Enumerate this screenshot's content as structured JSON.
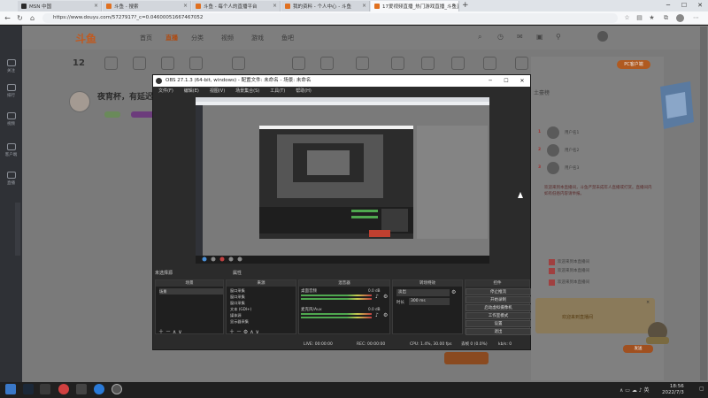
{
  "browser": {
    "tabs": [
      {
        "title": "MSN 中国",
        "active": false
      },
      {
        "title": "斗鱼 - 搜索",
        "active": false
      },
      {
        "title": "斗鱼 - 每个人的直播平台",
        "active": false
      },
      {
        "title": "我的资料 - 个人中心 - 斗鱼",
        "active": false
      },
      {
        "title": "17爱视频直播_热门游戏直播_斗鱼直播",
        "active": true
      }
    ],
    "url": "https://www.douyu.com/5727917?_c=0.04600051667467052",
    "new_tab": "+"
  },
  "page": {
    "logo": "斗鱼",
    "nav": [
      {
        "label": "首页",
        "active": false
      },
      {
        "label": "直播",
        "active": true
      },
      {
        "label": "分类",
        "active": false
      },
      {
        "label": "视频",
        "active": false
      },
      {
        "label": "游戏",
        "active": false
      },
      {
        "label": "鱼吧",
        "active": false
      }
    ],
    "left_sidebar": [
      "关注",
      "排行",
      "视频",
      "客户端",
      "直播"
    ],
    "host_title": "夜宵杯，有延迟",
    "host_level": "12",
    "pc_button": "PC客户端",
    "rank_title": "土豪榜",
    "rank_rows": [
      {
        "rank": "1",
        "name": "用户名1"
      },
      {
        "rank": "2",
        "name": "用户名2"
      },
      {
        "rank": "3",
        "name": "用户名3"
      }
    ],
    "chat_text": "欢迎来到本直播间，斗鱼严禁未成年人直播或打赏。直播间内如有低俗内容请举报。",
    "system_msgs": [
      "欢迎来到本直播间",
      "欢迎来到本直播间",
      "欢迎来到本直播间"
    ],
    "popup_text": "欢迎来到直播间",
    "send_button": "发送"
  },
  "obs": {
    "window_title": "OBS 27.1.3 (64-bit, windows) - 配置文件: 未命名 - 场景: 未命名",
    "menu": [
      "文件(F)",
      "编辑(E)",
      "视图(V)",
      "场景集合(S)",
      "工具(T)",
      "帮助(H)"
    ],
    "scene_label": "未选择源",
    "scene_status": "属性",
    "docks": {
      "scenes": {
        "header": "场景",
        "items": [
          "场景"
        ]
      },
      "sources": {
        "header": "来源",
        "items": [
          "窗口采集",
          "窗口采集",
          "窗口采集",
          "文本 (GDI+)",
          "媒体源",
          "显示器采集"
        ]
      },
      "mixer": {
        "header": "混音器",
        "channels": [
          {
            "name": "桌面音频",
            "db": "0.0 dB"
          },
          {
            "name": "麦克风/Aux",
            "db": "0.0 dB"
          }
        ]
      },
      "transitions": {
        "header": "转场特效",
        "type": "淡出",
        "duration_label": "时长",
        "duration": "300 ms"
      },
      "controls": {
        "header": "控件",
        "buttons": [
          "停止推流",
          "开始录制",
          "启动虚拟摄像机",
          "工作室模式",
          "设置",
          "退出"
        ]
      }
    },
    "status": {
      "dropped": "丢帧 0 (0.0%)",
      "live": "LIVE: 00:00:00",
      "rec": "REC: 00:00:00",
      "cpu": "CPU: 1.4%, 30.00 fps",
      "kbps": "kb/s: 0"
    }
  },
  "taskbar": {
    "time": "18:56",
    "date": "2022/7/3"
  },
  "colors": {
    "accent": "#c05a20",
    "obs_bg": "#2b2b2b",
    "taskbar": "#202020"
  }
}
